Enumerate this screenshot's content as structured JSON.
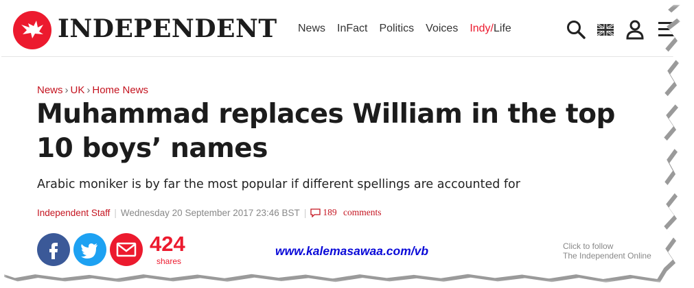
{
  "header": {
    "wordmark": "INDEPENDENT",
    "nav": [
      "News",
      "InFact",
      "Politics",
      "Voices"
    ],
    "nav_indy": "Indy/",
    "nav_life": "Life",
    "icons": [
      "search-icon",
      "uk-flag-icon",
      "user-icon",
      "menu-icon"
    ]
  },
  "breadcrumb": [
    "News",
    "UK",
    "Home News"
  ],
  "breadcrumb_separator": "›",
  "article": {
    "headline_line1": "Muhammad replaces William in the top",
    "headline_line2": "10 boys’ names",
    "standfirst": "Arabic moniker is by far the most popular if different spellings are accounted for",
    "author": "Independent Staff",
    "date": "Wednesday 20 September 2017 23:46 BST",
    "comments_count": "189",
    "comments_label": "comments"
  },
  "share": {
    "count": "424",
    "label": "shares",
    "buttons": [
      "facebook-icon",
      "twitter-icon",
      "email-icon"
    ]
  },
  "watermark": "www.kalemasawaa.com/vb",
  "follow": {
    "line1": "Click to follow",
    "line2": "The Independent Online"
  },
  "colors": {
    "brand_red": "#ec1a2e",
    "facebook": "#3b5998",
    "twitter": "#1da1f2",
    "watermark": "#0a0ad8"
  }
}
